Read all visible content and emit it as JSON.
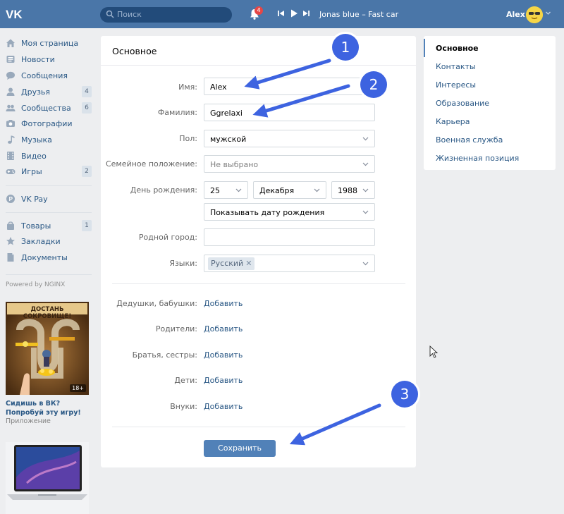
{
  "header": {
    "search_placeholder": "Поиск",
    "notification_count": "4",
    "track": "Jonas blue – Fast car",
    "user_name": "Alex"
  },
  "sidebar": {
    "items": [
      {
        "label": "Моя страница",
        "count": ""
      },
      {
        "label": "Новости",
        "count": ""
      },
      {
        "label": "Сообщения",
        "count": ""
      },
      {
        "label": "Друзья",
        "count": "4"
      },
      {
        "label": "Сообщества",
        "count": "6"
      },
      {
        "label": "Фотографии",
        "count": ""
      },
      {
        "label": "Музыка",
        "count": ""
      },
      {
        "label": "Видео",
        "count": ""
      },
      {
        "label": "Игры",
        "count": "2"
      },
      {
        "label": "VK Pay",
        "count": ""
      },
      {
        "label": "Товары",
        "count": "1"
      },
      {
        "label": "Закладки",
        "count": ""
      },
      {
        "label": "Документы",
        "count": ""
      }
    ],
    "powered_by": "Powered by NGINX",
    "ad": {
      "banner_title": "ДОСТАНЬ СОКРОВИЩЕ!",
      "age_badge": "18+",
      "text": "Сидишь в ВК? Попробуй эту игру!",
      "subtitle": "Приложение"
    }
  },
  "main": {
    "title": "Основное",
    "fields": {
      "first_name": {
        "label": "Имя:",
        "value": "Alex"
      },
      "last_name": {
        "label": "Фамилия:",
        "value": "Ggrelaxi"
      },
      "gender": {
        "label": "Пол:",
        "value": "мужской"
      },
      "marital": {
        "label": "Семейное положение:",
        "value": "Не выбрано"
      },
      "birthday": {
        "label": "День рождения:",
        "day": "25",
        "month": "Декабря",
        "year": "1988",
        "visibility": "Показывать дату рождения"
      },
      "hometown": {
        "label": "Родной город:",
        "value": ""
      },
      "languages": {
        "label": "Языки:",
        "value": "Русский"
      }
    },
    "relatives": [
      {
        "label": "Дедушки, бабушки:",
        "action": "Добавить"
      },
      {
        "label": "Родители:",
        "action": "Добавить"
      },
      {
        "label": "Братья, сестры:",
        "action": "Добавить"
      },
      {
        "label": "Дети:",
        "action": "Добавить"
      },
      {
        "label": "Внуки:",
        "action": "Добавить"
      }
    ],
    "save_label": "Сохранить"
  },
  "right_menu": {
    "items": [
      "Основное",
      "Контакты",
      "Интересы",
      "Образование",
      "Карьера",
      "Военная служба",
      "Жизненная позиция"
    ],
    "active": "Основное"
  },
  "annotations": {
    "callouts": [
      "1",
      "2",
      "3"
    ],
    "arrow_color": "#3d63e0"
  },
  "colors": {
    "header_bg": "#4a76a8",
    "link": "#2a5885",
    "button": "#5181b8",
    "page_bg": "#edeef0"
  }
}
